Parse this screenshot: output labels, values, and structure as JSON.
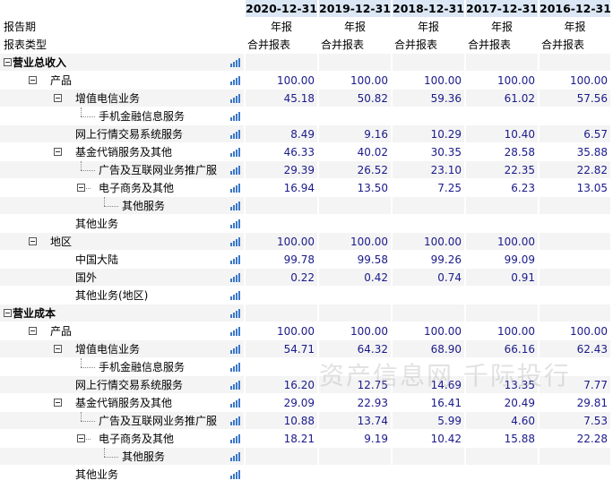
{
  "columns": [
    "2020-12-31",
    "2019-12-31",
    "2018-12-31",
    "2017-12-31",
    "2016-12-31"
  ],
  "report_period": {
    "label": "报告期",
    "values": [
      "年报",
      "年报",
      "年报",
      "年报",
      "年报"
    ]
  },
  "report_type": {
    "label": "报表类型",
    "values": [
      "合并报表",
      "合并报表",
      "合并报表",
      "合并报表",
      "合并报表"
    ]
  },
  "rows": [
    {
      "label": "营业总收入",
      "level": 0,
      "toggle": true,
      "bold": true,
      "values": [
        "",
        "",
        "",
        "",
        ""
      ]
    },
    {
      "label": "产品",
      "level": 1,
      "toggle": true,
      "values": [
        "100.00",
        "100.00",
        "100.00",
        "100.00",
        "100.00"
      ]
    },
    {
      "label": "增值电信业务",
      "level": 2,
      "toggle": true,
      "values": [
        "45.18",
        "50.82",
        "59.36",
        "61.02",
        "57.56"
      ]
    },
    {
      "label": "手机金融信息服务",
      "level": 3,
      "line": true,
      "values": [
        "",
        "",
        "",
        "",
        ""
      ]
    },
    {
      "label": "网上行情交易系统服务",
      "level": 2,
      "values": [
        "8.49",
        "9.16",
        "10.29",
        "10.40",
        "6.57"
      ]
    },
    {
      "label": "基金代销服务及其他",
      "level": 2,
      "toggle": true,
      "values": [
        "46.33",
        "40.02",
        "30.35",
        "28.58",
        "35.88"
      ]
    },
    {
      "label": "广告及互联网业务推广服",
      "level": 3,
      "line": true,
      "values": [
        "29.39",
        "26.52",
        "23.10",
        "22.35",
        "22.82"
      ]
    },
    {
      "label": "电子商务及其他",
      "level": 3,
      "toggle": true,
      "tline": true,
      "values": [
        "16.94",
        "13.50",
        "7.25",
        "6.23",
        "13.05"
      ]
    },
    {
      "label": "其他服务",
      "level": 4,
      "line": true,
      "values": [
        "",
        "",
        "",
        "",
        ""
      ]
    },
    {
      "label": "其他业务",
      "level": 2,
      "values": [
        "",
        "",
        "",
        "",
        ""
      ]
    },
    {
      "label": "地区",
      "level": 1,
      "toggle": true,
      "values": [
        "100.00",
        "100.00",
        "100.00",
        "100.00",
        ""
      ]
    },
    {
      "label": "中国大陆",
      "level": 2,
      "values": [
        "99.78",
        "99.58",
        "99.26",
        "99.09",
        ""
      ]
    },
    {
      "label": "国外",
      "level": 2,
      "values": [
        "0.22",
        "0.42",
        "0.74",
        "0.91",
        ""
      ]
    },
    {
      "label": "其他业务(地区)",
      "level": 2,
      "values": [
        "",
        "",
        "",
        "",
        ""
      ]
    },
    {
      "label": "营业成本",
      "level": 0,
      "toggle": true,
      "bold": true,
      "values": [
        "",
        "",
        "",
        "",
        ""
      ]
    },
    {
      "label": "产品",
      "level": 1,
      "toggle": true,
      "values": [
        "100.00",
        "100.00",
        "100.00",
        "100.00",
        "100.00"
      ]
    },
    {
      "label": "增值电信业务",
      "level": 2,
      "toggle": true,
      "values": [
        "54.71",
        "64.32",
        "68.90",
        "66.16",
        "62.43"
      ]
    },
    {
      "label": "手机金融信息服务",
      "level": 3,
      "line": true,
      "values": [
        "",
        "",
        "",
        "",
        ""
      ]
    },
    {
      "label": "网上行情交易系统服务",
      "level": 2,
      "values": [
        "16.20",
        "12.75",
        "14.69",
        "13.35",
        "7.77"
      ]
    },
    {
      "label": "基金代销服务及其他",
      "level": 2,
      "toggle": true,
      "values": [
        "29.09",
        "22.93",
        "16.41",
        "20.49",
        "29.81"
      ]
    },
    {
      "label": "广告及互联网业务推广服",
      "level": 3,
      "line": true,
      "values": [
        "10.88",
        "13.74",
        "5.99",
        "4.60",
        "7.53"
      ]
    },
    {
      "label": "电子商务及其他",
      "level": 3,
      "toggle": true,
      "tline": true,
      "values": [
        "18.21",
        "9.19",
        "10.42",
        "15.88",
        "22.28"
      ]
    },
    {
      "label": "其他服务",
      "level": 4,
      "line": true,
      "values": [
        "",
        "",
        "",
        "",
        ""
      ]
    },
    {
      "label": "其他业务",
      "level": 2,
      "values": [
        "",
        "",
        "",
        "",
        ""
      ]
    }
  ],
  "watermark": "资产信息网 千际投行",
  "icons": {
    "row_chart": "bar-chart-icon",
    "toggle": "collapse-toggle-icon"
  },
  "colors": {
    "header_bg": "#dbe7f5",
    "value_text": "#1a1a8c",
    "chart_icon": "#3b78c9",
    "stripe": "#f4f4f4"
  }
}
